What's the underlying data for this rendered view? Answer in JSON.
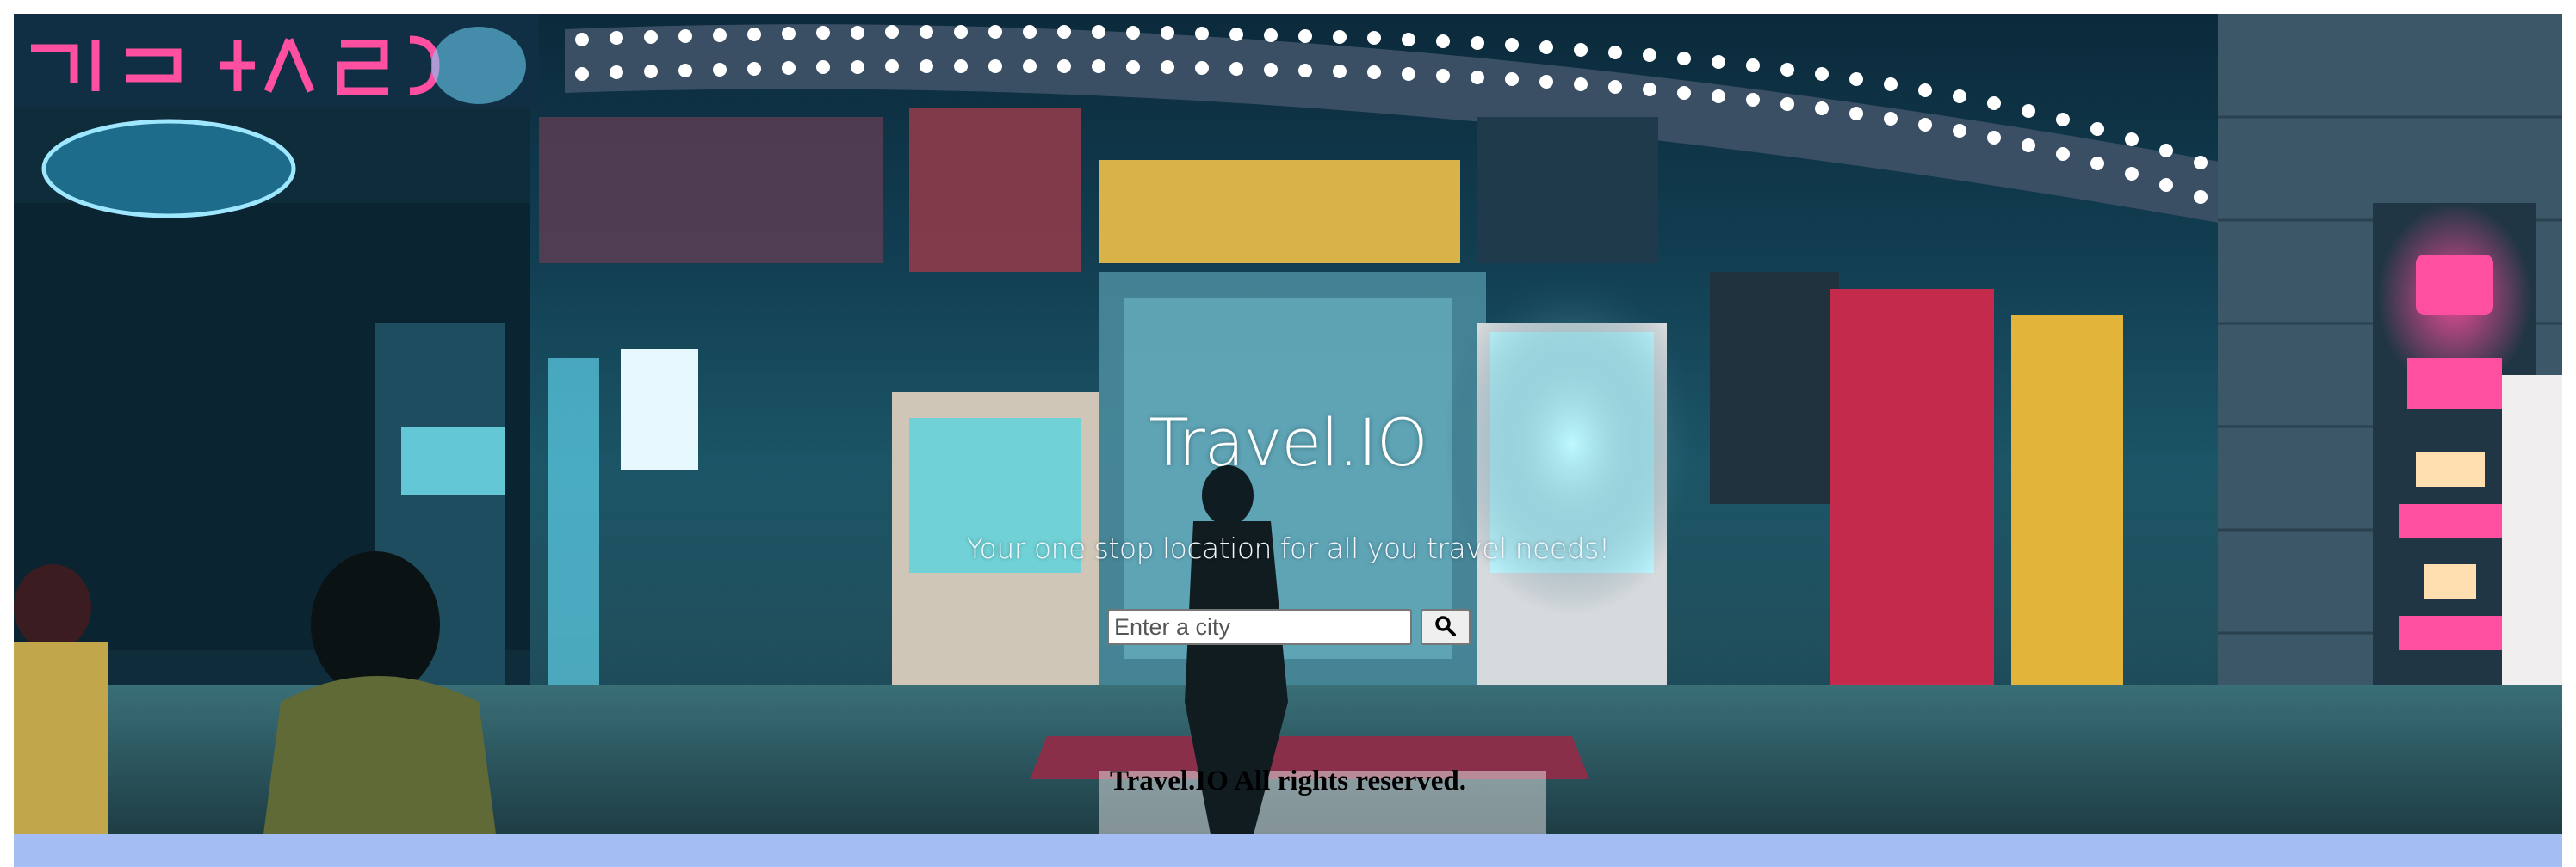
{
  "hero": {
    "brand_title": "Travel.IO",
    "tagline": "Your one stop location for all you travel needs!"
  },
  "search": {
    "placeholder": "Enter a city",
    "value": "",
    "button_icon": "search-icon"
  },
  "footer": {
    "text": "Travel.IO All rights reserved."
  },
  "colors": {
    "bottom_band": "#a4bdf2",
    "hero_tint": "#1b5566",
    "neon_pink": "#ff3b8f",
    "neon_cyan": "#7ff3ff",
    "footer_text": "#000000"
  }
}
